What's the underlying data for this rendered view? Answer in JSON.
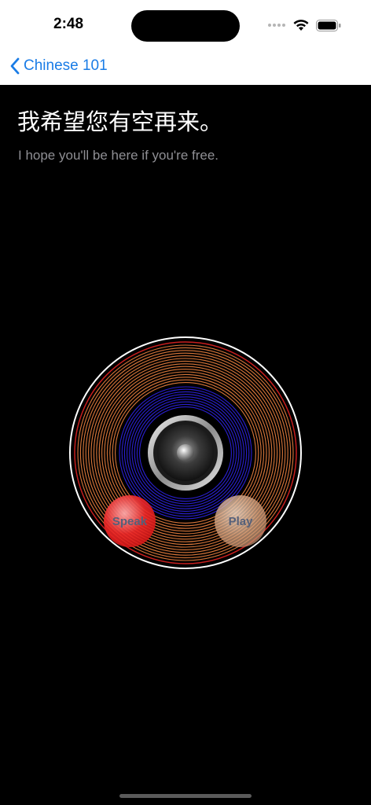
{
  "status": {
    "time": "2:48"
  },
  "nav": {
    "back_label": "Chinese 101"
  },
  "phrase": {
    "chinese": "我希望您有空再来。",
    "english": "I hope you'll be here if you're free."
  },
  "player": {
    "speak_label": "Speak",
    "play_label": "Play"
  },
  "colors": {
    "accent": "#1a7ce6",
    "outer_rings": "#d9773a",
    "inner_rings": "#2a1fd0",
    "edge_ring": "#c81e1e"
  }
}
